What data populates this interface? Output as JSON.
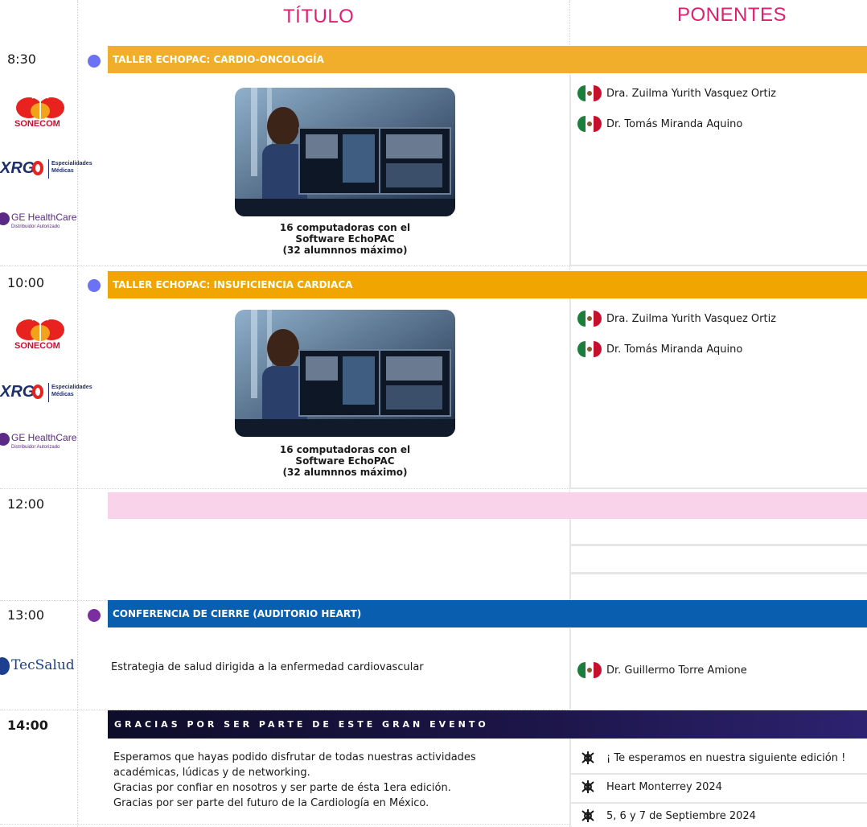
{
  "header": {
    "title_col": "TÍTULO",
    "speakers_col": "PONENTES"
  },
  "sessions": [
    {
      "time": "8:30",
      "title": "TALLER ECHOPAC: CARDIO-ONCOLOGÍA",
      "caption": "16 computadoras con el\nSoftware EchoPAC\n(32 alumnnos máximo)",
      "speakers": [
        "Dra. Zuilma Yurith Vasquez Ortiz",
        "Dr. Tomás Miranda Aquino"
      ]
    },
    {
      "time": "10:00",
      "title": "TALLER ECHOPAC: INSUFICIENCIA CARDIACA",
      "caption": "16 computadoras con el\nSoftware EchoPAC\n(32 alumnnos máximo)",
      "speakers": [
        "Dra. Zuilma Yurith Vasquez Ortiz",
        "Dr. Tomás Miranda Aquino"
      ]
    },
    {
      "time": "12:00"
    },
    {
      "time": "13:00",
      "title": "CONFERENCIA DE CIERRE (AUDITORIO HEART)",
      "talk": "Estrategia de salud dirigida a la enfermedad cardiovascular",
      "speakers": [
        "Dr. Guillermo Torre Amione"
      ]
    },
    {
      "time": "14:00",
      "title": "GRACIAS POR SER PARTE DE ESTE GRAN EVENTO",
      "message": [
        "Esperamos que hayas podido disfrutar de todas nuestras actividades",
        "académicas, lúdicas y de networking.",
        "Gracias por confiar en nosotros y ser parte de ésta 1era edición.",
        "Gracias por ser parte del futuro de la Cardiología en México."
      ],
      "announcements": [
        "¡ Te esperamos en nuestra siguiente edición !",
        "Heart Monterrey 2024",
        "5, 6 y 7 de Septiembre 2024"
      ]
    }
  ],
  "logos": {
    "sonecom": "SONECOM",
    "xrg": "Especialidades Médicas",
    "ge": "GE HealthCare",
    "ge_sub": "Distribuidor Autorizado",
    "tec": "TecSalud"
  },
  "colors": {
    "accent": "#e01f6f",
    "bar1": "#f0ae2a",
    "bar2": "#f0a500",
    "pink": "#f9d3ea",
    "blue": "#0a5eb0",
    "dark": "#1c1547",
    "dot_blue": "#6b72f5",
    "dot_purple": "#7a2ea0"
  }
}
